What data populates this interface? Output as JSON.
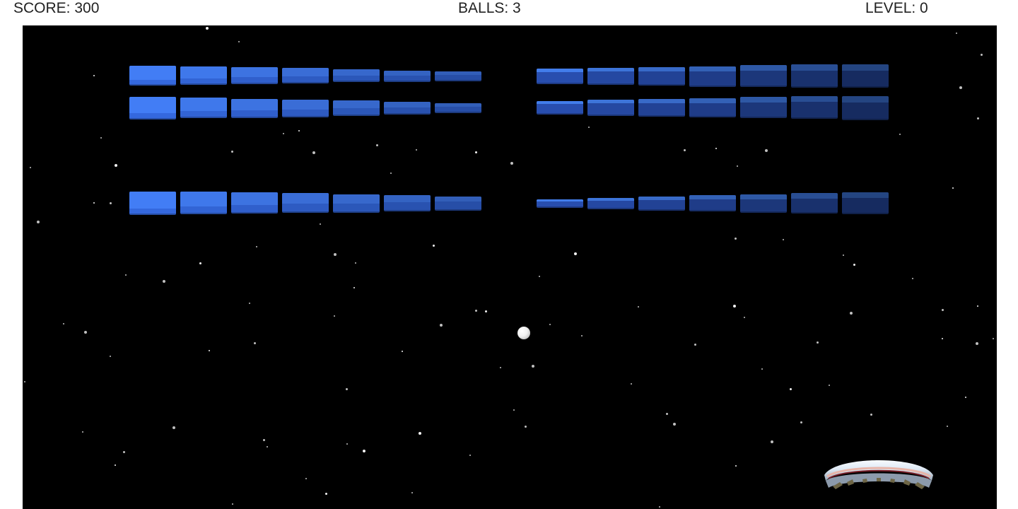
{
  "hud": {
    "score": "SCORE: 300",
    "balls": "BALLS: 3",
    "level": "LEVEL: 0"
  },
  "colors": {
    "background": "#000000",
    "hud_text": "#222222",
    "brick_light": "#3f7cf0",
    "brick_dark": "#1c3478",
    "star": "#ffffff",
    "ball": "#f0f0f0"
  },
  "bricks": {
    "rows": 3,
    "per_row": 14,
    "total": 42
  },
  "icons": {
    "ball": "ball-icon",
    "paddle": "paddle-icon"
  }
}
